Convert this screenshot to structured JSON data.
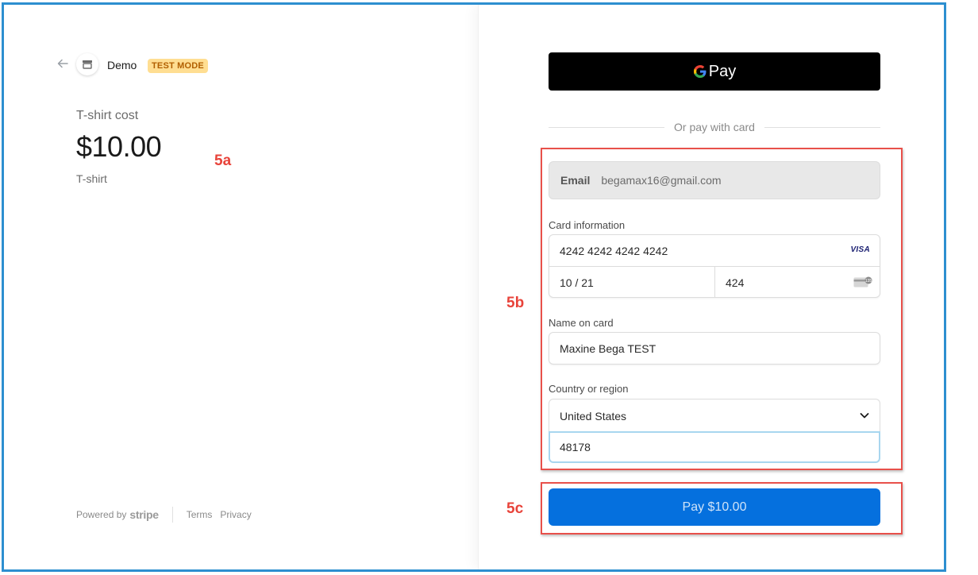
{
  "merchant": {
    "name": "Demo",
    "badge": "TEST MODE"
  },
  "product": {
    "label": "T-shirt cost",
    "price": "$10.00",
    "name": "T-shirt"
  },
  "footer": {
    "powered_by": "Powered by",
    "brand": "stripe",
    "terms": "Terms",
    "privacy": "Privacy"
  },
  "payment": {
    "gpay_label": "Pay",
    "divider_text": "Or pay with card",
    "email": {
      "label": "Email",
      "value": "begamax16@gmail.com"
    },
    "card": {
      "label": "Card information",
      "number": "4242 4242 4242 4242",
      "brand": "VISA",
      "expiry": "10 / 21",
      "cvc": "424"
    },
    "name_on_card": {
      "label": "Name on card",
      "value": "Maxine Bega TEST"
    },
    "country": {
      "label": "Country or region",
      "value": "United States",
      "zip": "48178"
    },
    "pay_button": "Pay $10.00"
  },
  "annotations": {
    "a": "5a",
    "b": "5b",
    "c": "5c"
  },
  "colors": {
    "accent": "#0570de",
    "annotation": "#e8433a",
    "badge_bg": "#ffde92",
    "badge_text": "#b15f00",
    "frame": "#2d8fd0"
  }
}
